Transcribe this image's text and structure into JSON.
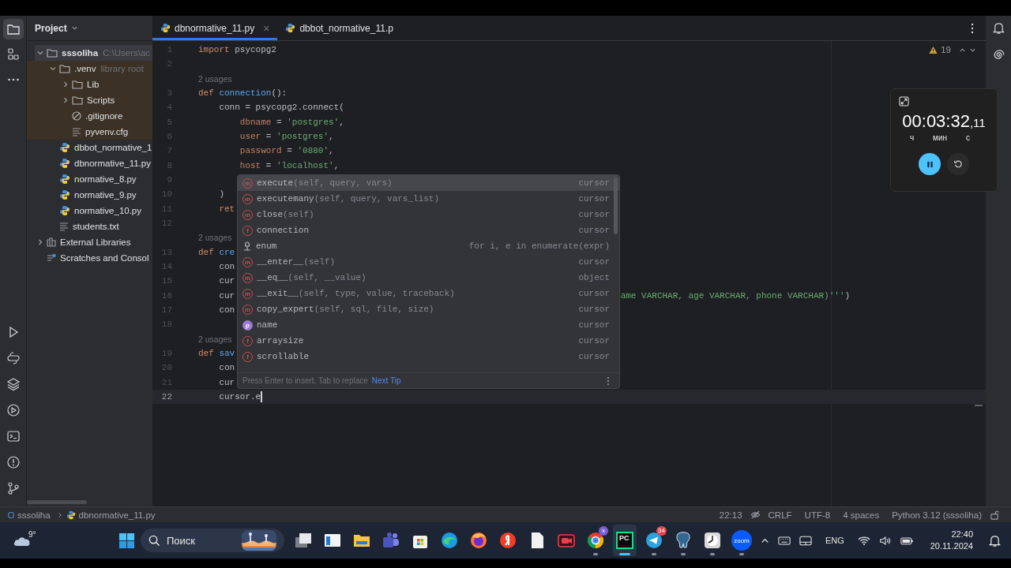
{
  "left_toolbar": {
    "top": [
      {
        "kind": "folder",
        "selected": true
      },
      {
        "kind": "structure",
        "selected": false
      },
      {
        "kind": "more",
        "selected": false
      }
    ],
    "bottom": [
      {
        "kind": "run"
      },
      {
        "kind": "console"
      },
      {
        "kind": "layers"
      },
      {
        "kind": "services"
      },
      {
        "kind": "terminal"
      },
      {
        "kind": "problems"
      },
      {
        "kind": "git"
      }
    ]
  },
  "project_panel": {
    "title": "Project",
    "tree": [
      {
        "label": "sssoliha",
        "hint": "C:\\Users\\ac",
        "kind": "folder",
        "expanded": true,
        "selected": true,
        "library_root": false,
        "children": [
          {
            "label": ".venv",
            "hint": "library root",
            "kind": "folder",
            "expanded": true,
            "selected": false,
            "library_root": true,
            "children": [
              {
                "label": "Lib",
                "kind": "folder",
                "expanded": false,
                "selected": false
              },
              {
                "label": "Scripts",
                "kind": "folder",
                "expanded": false,
                "selected": false
              },
              {
                "label": ".gitignore",
                "kind": "ignore",
                "selected": false
              },
              {
                "label": "pyvenv.cfg",
                "kind": "text",
                "selected": false
              }
            ]
          },
          {
            "label": "dbbot_normative_1",
            "kind": "python",
            "selected": false,
            "library_root": false
          },
          {
            "label": "dbnormative_11.py",
            "kind": "python",
            "selected": false,
            "library_root": false
          },
          {
            "label": "normative_8.py",
            "kind": "python",
            "selected": false,
            "library_root": false
          },
          {
            "label": "normative_9.py",
            "kind": "python",
            "selected": false,
            "library_root": false
          },
          {
            "label": "normative_10.py",
            "kind": "python",
            "selected": false,
            "library_root": false
          },
          {
            "label": "students.txt",
            "kind": "text",
            "selected": false,
            "library_root": false
          }
        ]
      },
      {
        "label": "External Libraries",
        "kind": "library",
        "expanded": false,
        "selected": false,
        "library_root": false
      },
      {
        "label": "Scratches and Consol",
        "kind": "scratch",
        "selected": false,
        "library_root": false
      }
    ]
  },
  "tabs": [
    {
      "label": "dbnormative_11.py",
      "selected": true,
      "closable": true,
      "close": "×"
    },
    {
      "label": "dbbot_normative_11.p",
      "selected": false,
      "closable": false
    }
  ],
  "inspection": {
    "warnings": "19"
  },
  "code": [
    {
      "number": "1",
      "tokens": [
        {
          "text": "import ",
          "kind": "kw"
        },
        {
          "text": "psycopg2",
          "kind": "plain"
        }
      ]
    },
    {
      "number": "2"
    },
    {
      "kind": "hint",
      "text": "2 usages"
    },
    {
      "number": "3",
      "tokens": [
        {
          "text": "def ",
          "kind": "kw"
        },
        {
          "text": "connection",
          "kind": "fn"
        },
        {
          "text": "():",
          "kind": "plain"
        }
      ]
    },
    {
      "number": "4",
      "tokens": [
        {
          "text": "    conn = psycopg2.connect(",
          "kind": "plain"
        }
      ]
    },
    {
      "number": "5",
      "tokens": [
        {
          "text": "        dbname",
          "kind": "arg"
        },
        {
          "text": " = ",
          "kind": "plain"
        },
        {
          "text": "'postgres'",
          "kind": "str"
        },
        {
          "text": ",",
          "kind": "plain"
        }
      ]
    },
    {
      "number": "6",
      "tokens": [
        {
          "text": "        user",
          "kind": "arg"
        },
        {
          "text": " = ",
          "kind": "plain"
        },
        {
          "text": "'postgres'",
          "kind": "str"
        },
        {
          "text": ",",
          "kind": "plain"
        }
      ]
    },
    {
      "number": "7",
      "tokens": [
        {
          "text": "        password",
          "kind": "arg"
        },
        {
          "text": " = ",
          "kind": "plain"
        },
        {
          "text": "'0880'",
          "kind": "str"
        },
        {
          "text": ",",
          "kind": "plain"
        }
      ]
    },
    {
      "number": "8",
      "tokens": [
        {
          "text": "        host",
          "kind": "arg"
        },
        {
          "text": " = ",
          "kind": "plain"
        },
        {
          "text": "'localhost'",
          "kind": "str"
        },
        {
          "text": ",",
          "kind": "plain"
        }
      ]
    },
    {
      "number": "9"
    },
    {
      "number": "10",
      "tokens": [
        {
          "text": "    )",
          "kind": "plain"
        }
      ]
    },
    {
      "number": "11",
      "tokens": [
        {
          "text": "    ret",
          "kind": "kw"
        }
      ]
    },
    {
      "number": "12"
    },
    {
      "kind": "hint",
      "text": "2 usages"
    },
    {
      "number": "13",
      "tokens": [
        {
          "text": "def ",
          "kind": "kw"
        },
        {
          "text": "cre",
          "kind": "fn"
        }
      ]
    },
    {
      "number": "14",
      "tokens": [
        {
          "text": "    con",
          "kind": "plain"
        }
      ]
    },
    {
      "number": "15",
      "tokens": [
        {
          "text": "    cur",
          "kind": "plain"
        }
      ]
    },
    {
      "number": "16",
      "tokens": [
        {
          "text": "    cur",
          "kind": "plain"
        }
      ],
      "tail": [
        {
          "text": "ame VARCHAR, age VARCHAR, phone VARCHAR)'''",
          "kind": "str"
        },
        {
          "text": ")",
          "kind": "plain"
        }
      ]
    },
    {
      "number": "17",
      "tokens": [
        {
          "text": "    con",
          "kind": "plain"
        }
      ]
    },
    {
      "number": "18"
    },
    {
      "kind": "hint",
      "text": "2 usages"
    },
    {
      "number": "19",
      "tokens": [
        {
          "text": "def ",
          "kind": "kw"
        },
        {
          "text": "sav",
          "kind": "fn"
        }
      ]
    },
    {
      "number": "20",
      "tokens": [
        {
          "text": "    con",
          "kind": "plain"
        }
      ]
    },
    {
      "number": "21",
      "tokens": [
        {
          "text": "    cur",
          "kind": "plain"
        }
      ]
    },
    {
      "number": "22",
      "tokens": [
        {
          "text": "    cursor.e",
          "kind": "plain"
        }
      ],
      "current": true
    }
  ],
  "completion": {
    "items": [
      {
        "kind": "method",
        "badge": "m",
        "name": "execute",
        "signature": "(self, query, vars)",
        "type": "cursor",
        "selected": true
      },
      {
        "kind": "method",
        "badge": "m",
        "name": "executemany",
        "signature": "(self, query, vars_list)",
        "type": "cursor",
        "selected": false
      },
      {
        "kind": "method",
        "badge": "m",
        "name": "close",
        "signature": "(self)",
        "type": "cursor",
        "selected": false
      },
      {
        "kind": "field",
        "badge": "f",
        "name": "connection",
        "type": "cursor",
        "selected": false
      },
      {
        "kind": "template",
        "name": "enum",
        "type": "for i, e in enumerate(expr)",
        "selected": false
      },
      {
        "kind": "method",
        "badge": "m",
        "name": "__enter__",
        "signature": "(self)",
        "type": "cursor",
        "selected": false
      },
      {
        "kind": "method",
        "badge": "m",
        "name": "__eq__",
        "signature": "(self, __value)",
        "type": "object",
        "selected": false
      },
      {
        "kind": "method",
        "badge": "m",
        "name": "__exit__",
        "signature": "(self, type, value, traceback)",
        "type": "cursor",
        "selected": false
      },
      {
        "kind": "method",
        "badge": "m",
        "name": "copy_expert",
        "signature": "(self, sql, file, size)",
        "type": "cursor",
        "selected": false
      },
      {
        "kind": "property",
        "badge": "p",
        "name": "name",
        "type": "cursor",
        "selected": false
      },
      {
        "kind": "field",
        "badge": "f",
        "name": "arraysize",
        "type": "cursor",
        "selected": false
      },
      {
        "kind": "field",
        "badge": "f",
        "name": "scrollable",
        "type": "cursor",
        "selected": false
      }
    ],
    "hint": "Press Enter to insert, Tab to replace",
    "link": "Next Tip"
  },
  "timer": {
    "time": "00:03:32",
    "fraction": ",11",
    "units": [
      "ч",
      "мин",
      "с"
    ],
    "running": true
  },
  "status_bar": {
    "breadcrumb": [
      "sssoliha",
      "dbnormative_11.py"
    ],
    "position": "22:13",
    "line_separator": "CRLF",
    "encoding": "UTF-8",
    "indent": "4 spaces",
    "interpreter": "Python 3.12 (sssoliha)"
  },
  "taskbar": {
    "weather": "9°",
    "search_placeholder": "Поиск",
    "apps": [
      {
        "kind": "taskview",
        "running": false,
        "selected": false
      },
      {
        "kind": "window",
        "running": false,
        "selected": false
      },
      {
        "kind": "explorer",
        "running": false,
        "selected": false
      },
      {
        "kind": "teams",
        "running": false,
        "selected": false
      },
      {
        "kind": "store",
        "running": false,
        "selected": false
      },
      {
        "kind": "edge",
        "running": false,
        "selected": false
      },
      {
        "kind": "firefox",
        "running": false,
        "selected": false
      },
      {
        "kind": "yandex",
        "running": false,
        "selected": false
      },
      {
        "kind": "file",
        "running": false,
        "selected": false
      },
      {
        "kind": "recorder",
        "running": false,
        "selected": false
      },
      {
        "kind": "chrome",
        "running": true,
        "selected": false,
        "badge": "x"
      },
      {
        "kind": "pycharm",
        "running": true,
        "selected": true,
        "logo": "PC"
      },
      {
        "kind": "telegram",
        "running": true,
        "selected": false,
        "badge": "34"
      },
      {
        "kind": "postgres",
        "running": true,
        "selected": false
      },
      {
        "kind": "clock",
        "running": true,
        "selected": false
      },
      {
        "kind": "zoom",
        "running": true,
        "selected": false,
        "logo": "zoom"
      }
    ],
    "language": "ENG",
    "time": "22:40",
    "date": "20.11.2024"
  }
}
